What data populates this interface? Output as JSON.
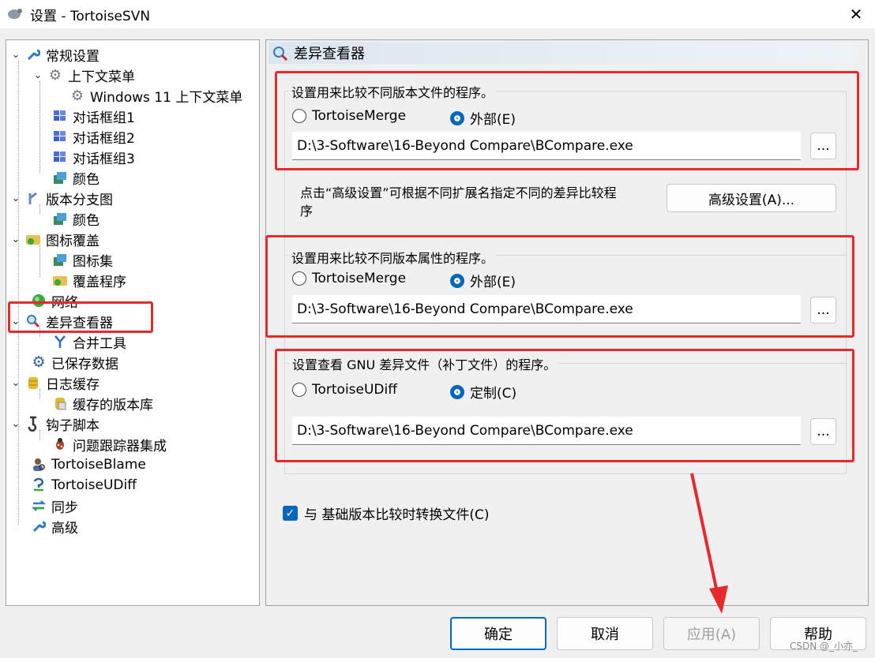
{
  "window": {
    "title": "设置 - TortoiseSVN",
    "close_symbol": "✕"
  },
  "tree": {
    "items": [
      {
        "label": "常规设置",
        "icon": "wrench-icon"
      },
      {
        "label": "上下文菜单",
        "icon": "gear-icon"
      },
      {
        "label": "Windows 11 上下文菜单",
        "icon": "gear-icon"
      },
      {
        "label": "对话框组1",
        "icon": "windows-flag-icon"
      },
      {
        "label": "对话框组2",
        "icon": "windows-flag-icon"
      },
      {
        "label": "对话框组3",
        "icon": "windows-flag-icon"
      },
      {
        "label": "颜色",
        "icon": "palette-icon"
      },
      {
        "label": "版本分支图",
        "icon": "branch-graph-icon"
      },
      {
        "label": "颜色",
        "icon": "palette-icon"
      },
      {
        "label": "图标覆盖",
        "icon": "folder-overlay-icon"
      },
      {
        "label": "图标集",
        "icon": "palette-icon"
      },
      {
        "label": "覆盖程序",
        "icon": "folder-overlay-icon"
      },
      {
        "label": "网络",
        "icon": "globe-icon"
      },
      {
        "label": "差异查看器",
        "icon": "magnifier-icon"
      },
      {
        "label": "合并工具",
        "icon": "merge-icon"
      },
      {
        "label": "已保存数据",
        "icon": "gear-icon"
      },
      {
        "label": "日志缓存",
        "icon": "database-icon"
      },
      {
        "label": "缓存的版本库",
        "icon": "database-icon"
      },
      {
        "label": "钩子脚本",
        "icon": "hook-icon"
      },
      {
        "label": "问题跟踪器集成",
        "icon": "bug-icon"
      },
      {
        "label": "TortoiseBlame",
        "icon": "person-search-icon"
      },
      {
        "label": "TortoiseUDiff",
        "icon": "diff-icon"
      },
      {
        "label": "同步",
        "icon": "sync-icon"
      },
      {
        "label": "高级",
        "icon": "wrench-icon"
      }
    ]
  },
  "panel": {
    "title": "差异查看器",
    "file_group": {
      "label": "设置用来比较不同版本文件的程序。",
      "option_internal": "TortoiseMerge",
      "option_external": "外部(E)",
      "path": "D:\\3-Software\\16-Beyond Compare\\BCompare.exe",
      "browse": "..."
    },
    "advanced_note": "点击“高级设置”可根据不同扩展名指定不同的差异比较程序",
    "advanced_button": "高级设置(A)...",
    "prop_group": {
      "label": "设置用来比较不同版本属性的程序。",
      "option_internal": "TortoiseMerge",
      "option_external": "外部(E)",
      "path": "D:\\3-Software\\16-Beyond Compare\\BCompare.exe",
      "browse": "..."
    },
    "gnu_group": {
      "label": "设置查看 GNU 差异文件（补丁文件）的程序。",
      "option_internal": "TortoiseUDiff",
      "option_custom": "定制(C)",
      "path": "D:\\3-Software\\16-Beyond Compare\\BCompare.exe",
      "browse": "..."
    },
    "convert_checkbox": {
      "label": "与 基础版本比较时转换文件(C)",
      "checked": true
    }
  },
  "footer": {
    "ok": "确定",
    "cancel": "取消",
    "apply": "应用(A)",
    "help": "帮助"
  },
  "watermark": "CSDN @_小亦_",
  "colors": {
    "accent": "#0067c0",
    "annotation_red": "#e8282a"
  }
}
